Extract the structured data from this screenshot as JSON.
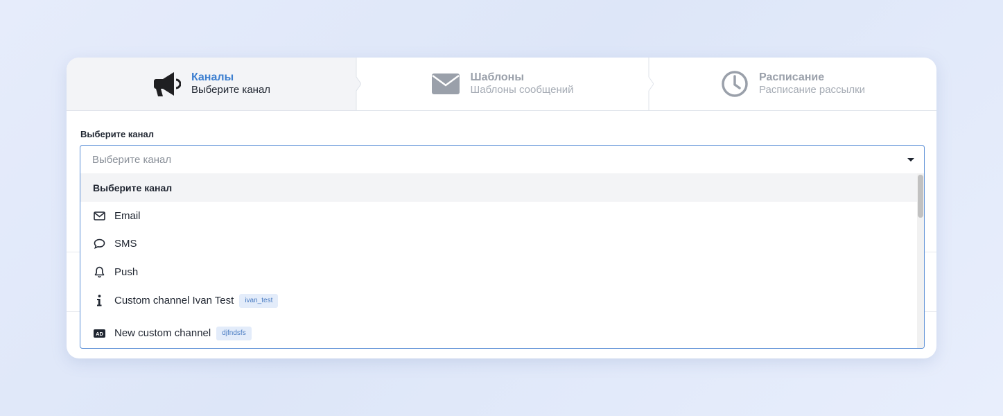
{
  "steps": [
    {
      "title": "Каналы",
      "subtitle": "Выберите канал",
      "icon": "megaphone-icon",
      "state": "active"
    },
    {
      "title": "Шаблоны",
      "subtitle": "Шаблоны сообщений",
      "icon": "envelope-icon",
      "state": "inactive"
    },
    {
      "title": "Расписание",
      "subtitle": "Расписание рассылки",
      "icon": "clock-icon",
      "state": "inactive"
    }
  ],
  "channel_field": {
    "label": "Выберите канал",
    "placeholder": "Выберите канал"
  },
  "options": [
    {
      "label": "Выберите канал",
      "type": "header"
    },
    {
      "label": "Email",
      "icon": "envelope-icon"
    },
    {
      "label": "SMS",
      "icon": "chat-bubble-icon"
    },
    {
      "label": "Push",
      "icon": "bell-icon"
    },
    {
      "label": "Custom channel Ivan Test",
      "icon": "info-icon",
      "tag": "ivan_test"
    },
    {
      "label": "New custom channel",
      "icon": "ad-icon",
      "tag": "djfndsfs"
    }
  ],
  "colors": {
    "accent": "#3d7fd0",
    "inactive": "#9aa0aa",
    "tag_bg": "#e3ecfa",
    "tag_text": "#4a7cc2"
  }
}
